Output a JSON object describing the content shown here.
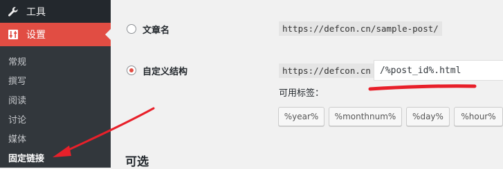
{
  "sidebar": {
    "tools_label": "工具",
    "settings_label": "设置",
    "submenu": [
      {
        "label": "常规"
      },
      {
        "label": "撰写"
      },
      {
        "label": "阅读"
      },
      {
        "label": "讨论"
      },
      {
        "label": "媒体"
      },
      {
        "label": "固定链接",
        "current": true
      }
    ]
  },
  "permalink": {
    "option_post_name": {
      "label": "文章名",
      "example": "https://defcon.cn/sample-post/",
      "checked": false
    },
    "option_custom": {
      "label": "自定义结构",
      "prefix": "https://defcon.cn",
      "value": "/%post_id%.html",
      "checked": true
    },
    "available_tags_label": "可用标签：",
    "tags": [
      "%year%",
      "%monthnum%",
      "%day%",
      "%hour%"
    ]
  },
  "optional_section_title": "可选",
  "colors": {
    "accent": "#e14d43",
    "sidebar_bg": "#23282d",
    "submenu_bg": "#32373c",
    "annotation_red": "#e8202a"
  }
}
